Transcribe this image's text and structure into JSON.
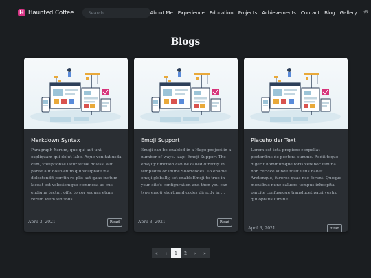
{
  "brand": {
    "logo_letter": "H",
    "name": "Haunted Coffee"
  },
  "search": {
    "placeholder": "Search ..."
  },
  "nav": {
    "links": [
      "About Me",
      "Experience",
      "Education",
      "Projects",
      "Achievements",
      "Contact",
      "Blog",
      "Gallery"
    ],
    "theme_icon": "☼"
  },
  "page": {
    "title": "Blogs"
  },
  "posts": [
    {
      "title": "Markdown Syntax",
      "excerpt": "Paragraph Xerum, quo qui aut unt expliquam qui dolut labo. Aque venitatiusda cum, voluptionse latur sitiae dolessi aut parist aut dollo enim qui voluptate ma dolestendit peritin re plis aut quas inctum laceat est volestemque commosa as cus endigna tectur, offic to cor sequas etum rerum idem sintibus ...",
      "date": "April 3, 2021",
      "read_label": "Read"
    },
    {
      "title": "Emoji Support",
      "excerpt": "Emoji can be enabled in a Hugo project in a number of ways. :zap: Emoji Support The emojify function can be called directly in templates or Inline Shortcodes. To enable emoji globally, set enableEmoji to true in your site's configuration and then you can type emoji shorthand codes directly in ...",
      "date": "April 3, 2021",
      "read_label": "Read"
    },
    {
      "title": "Placeholder Text",
      "excerpt": "Lorem est tota propiore conpellat pectoribus de pectora summo. Redit teque digerit hominumque toris verebor lumina non cervice subde tollit usus habet Arctonque, furores quas nec ferunt. Quoque montibus nunc caluere tempus inhospita parcite confusaque translucet patri vestro qui optatis lumine ...",
      "date": "April 3, 2021",
      "read_label": "Read"
    }
  ],
  "pagination": {
    "first": "«",
    "prev": "‹",
    "pages": [
      "1",
      "2"
    ],
    "active_page": "1",
    "next": "›",
    "last": "»"
  },
  "colors": {
    "background": "#1b1e21",
    "card": "#2a2e33",
    "accent": "#d63384"
  }
}
